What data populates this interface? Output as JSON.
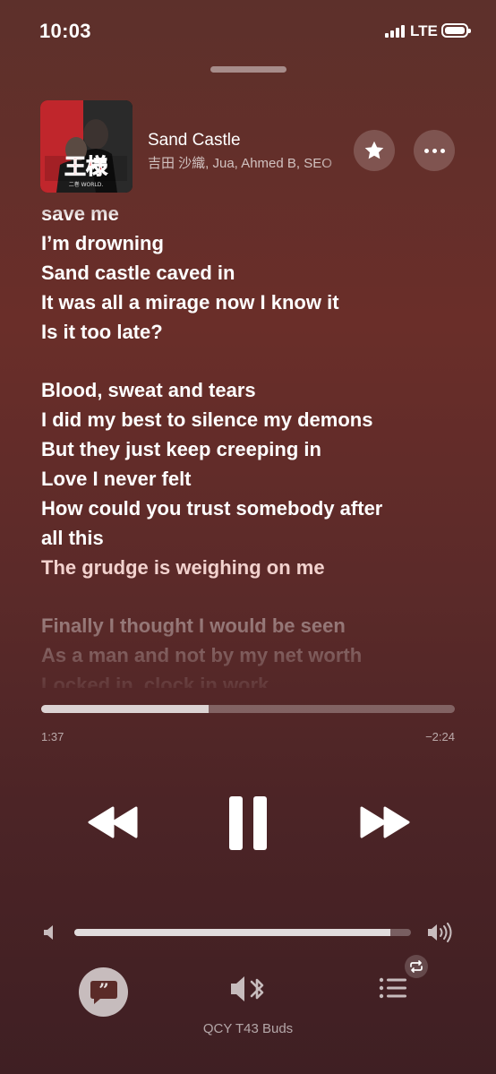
{
  "status_bar": {
    "time": "10:03",
    "network": "LTE"
  },
  "now_playing": {
    "title": "Sand Castle",
    "artist": "吉田 沙織, Jua, Ahmed B, SEO",
    "album_art_text": "王様 二巻 WORLD.",
    "accent_color": "#c0262c"
  },
  "lyrics": {
    "lines": [
      {
        "text": "save me",
        "state": "past"
      },
      {
        "text": "I’m drowning",
        "state": "past"
      },
      {
        "text": "Sand castle caved in",
        "state": "past"
      },
      {
        "text": "It was all a mirage now I know it",
        "state": "past"
      },
      {
        "text": "Is it too late?",
        "state": "past"
      },
      {
        "text": "",
        "state": "gap"
      },
      {
        "text": "Blood, sweat and tears",
        "state": "past"
      },
      {
        "text": "I did my best to silence my demons",
        "state": "past"
      },
      {
        "text": "But they just keep creeping in",
        "state": "past"
      },
      {
        "text": "Love I never felt",
        "state": "past"
      },
      {
        "text": "How could you trust somebody after",
        "state": "past"
      },
      {
        "text": "all this",
        "state": "past"
      },
      {
        "text": "The grudge is weighing on me",
        "state": "current"
      },
      {
        "text": "",
        "state": "gap"
      },
      {
        "text": "Finally I thought I would be seen",
        "state": "upcoming"
      },
      {
        "text": "As a man and not by my net worth",
        "state": "upcoming"
      },
      {
        "text": "Locked in, clock in work",
        "state": "upcoming"
      }
    ]
  },
  "playback": {
    "elapsed": "1:37",
    "remaining": "−2:24",
    "progress_fraction": 0.405,
    "state": "playing"
  },
  "volume": {
    "level_fraction": 0.94
  },
  "bottom_bar": {
    "output_device": "QCY T43 Buds"
  },
  "icons": {
    "favorite": "star-icon",
    "more": "more-icon",
    "rewind": "rewind-icon",
    "pause": "pause-icon",
    "forward": "fast-forward-icon",
    "lyrics": "lyrics-quote-icon",
    "output": "bluetooth-speaker-icon",
    "queue": "queue-list-icon",
    "repeat": "repeat-icon"
  }
}
